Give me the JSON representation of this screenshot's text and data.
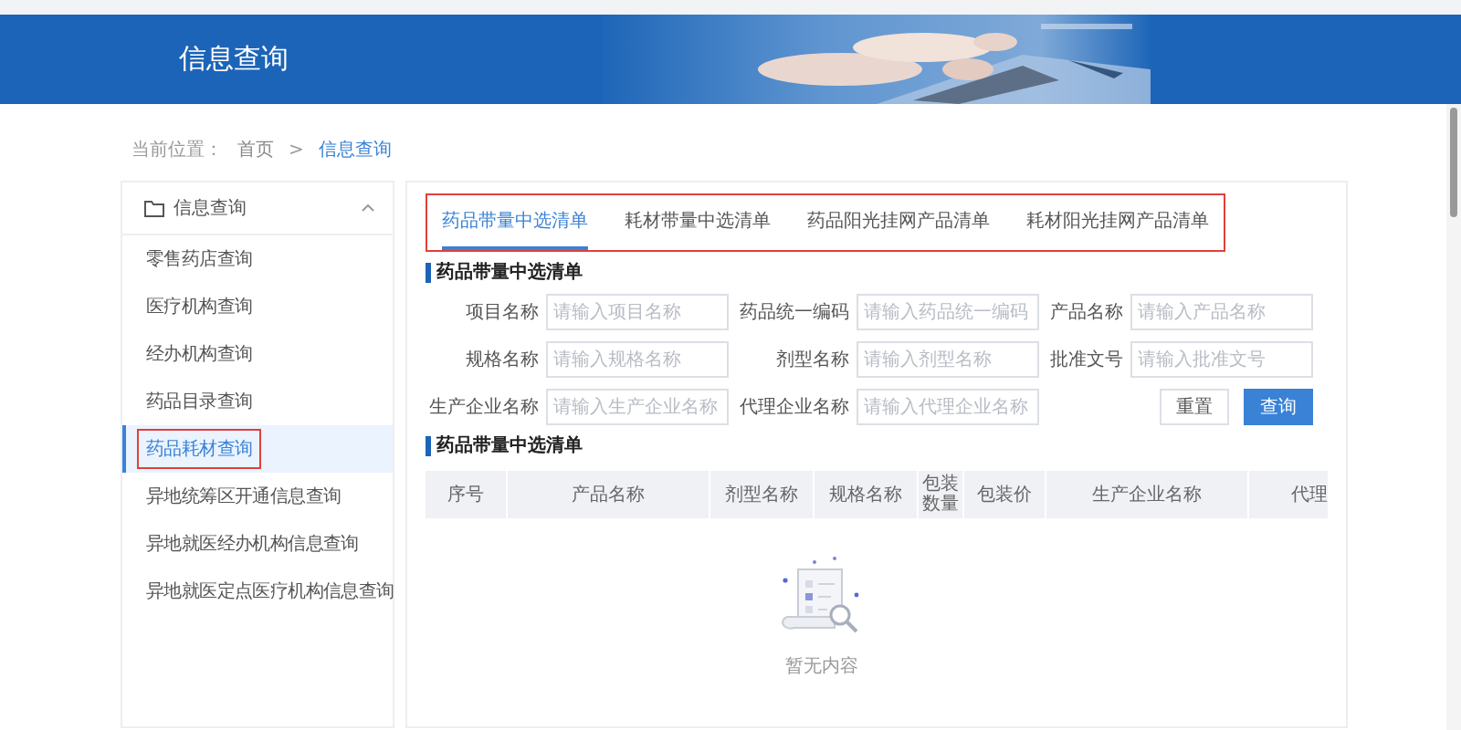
{
  "header": {
    "title": "信息查询"
  },
  "breadcrumb": {
    "label": "当前位置：",
    "separator": ">",
    "items": [
      {
        "text": "首页",
        "selected": false
      },
      {
        "text": "信息查询",
        "selected": true
      }
    ]
  },
  "sidebar": {
    "title": "信息查询",
    "expanded": true,
    "items": [
      {
        "label": "零售药店查询",
        "selected": false,
        "highlighted": false
      },
      {
        "label": "医疗机构查询",
        "selected": false,
        "highlighted": false
      },
      {
        "label": "经办机构查询",
        "selected": false,
        "highlighted": false
      },
      {
        "label": "药品目录查询",
        "selected": false,
        "highlighted": false
      },
      {
        "label": "药品耗材查询",
        "selected": true,
        "highlighted": true
      },
      {
        "label": "异地统筹区开通信息查询",
        "selected": false,
        "highlighted": false
      },
      {
        "label": "异地就医经办机构信息查询",
        "selected": false,
        "highlighted": false
      },
      {
        "label": "异地就医定点医疗机构信息查询",
        "selected": false,
        "highlighted": false
      }
    ]
  },
  "tabs": {
    "highlighted": true,
    "items": [
      {
        "label": "药品带量中选清单",
        "selected": true
      },
      {
        "label": "耗材带量中选清单",
        "selected": false
      },
      {
        "label": "药品阳光挂网产品清单",
        "selected": false
      },
      {
        "label": "耗材阳光挂网产品清单",
        "selected": false
      }
    ]
  },
  "form": {
    "title": "药品带量中选清单",
    "fields": [
      {
        "label": "项目名称",
        "placeholder": "请输入项目名称"
      },
      {
        "label": "药品统一编码",
        "placeholder": "请输入药品统一编码"
      },
      {
        "label": "产品名称",
        "placeholder": "请输入产品名称"
      },
      {
        "label": "规格名称",
        "placeholder": "请输入规格名称"
      },
      {
        "label": "剂型名称",
        "placeholder": "请输入剂型名称"
      },
      {
        "label": "批准文号",
        "placeholder": "请输入批准文号"
      },
      {
        "label": "生产企业名称",
        "placeholder": "请输入生产企业名称"
      },
      {
        "label": "代理企业名称",
        "placeholder": "请输入代理企业名称"
      }
    ],
    "buttons": [
      {
        "label": "重置",
        "kind": "default"
      },
      {
        "label": "查询",
        "kind": "primary"
      }
    ]
  },
  "table": {
    "title": "药品带量中选清单",
    "columns": [
      "序号",
      "产品名称",
      "剂型名称",
      "规格名称",
      "包装数量",
      "包装价",
      "生产企业名称",
      "代理"
    ],
    "empty_text": "暂无内容"
  }
}
